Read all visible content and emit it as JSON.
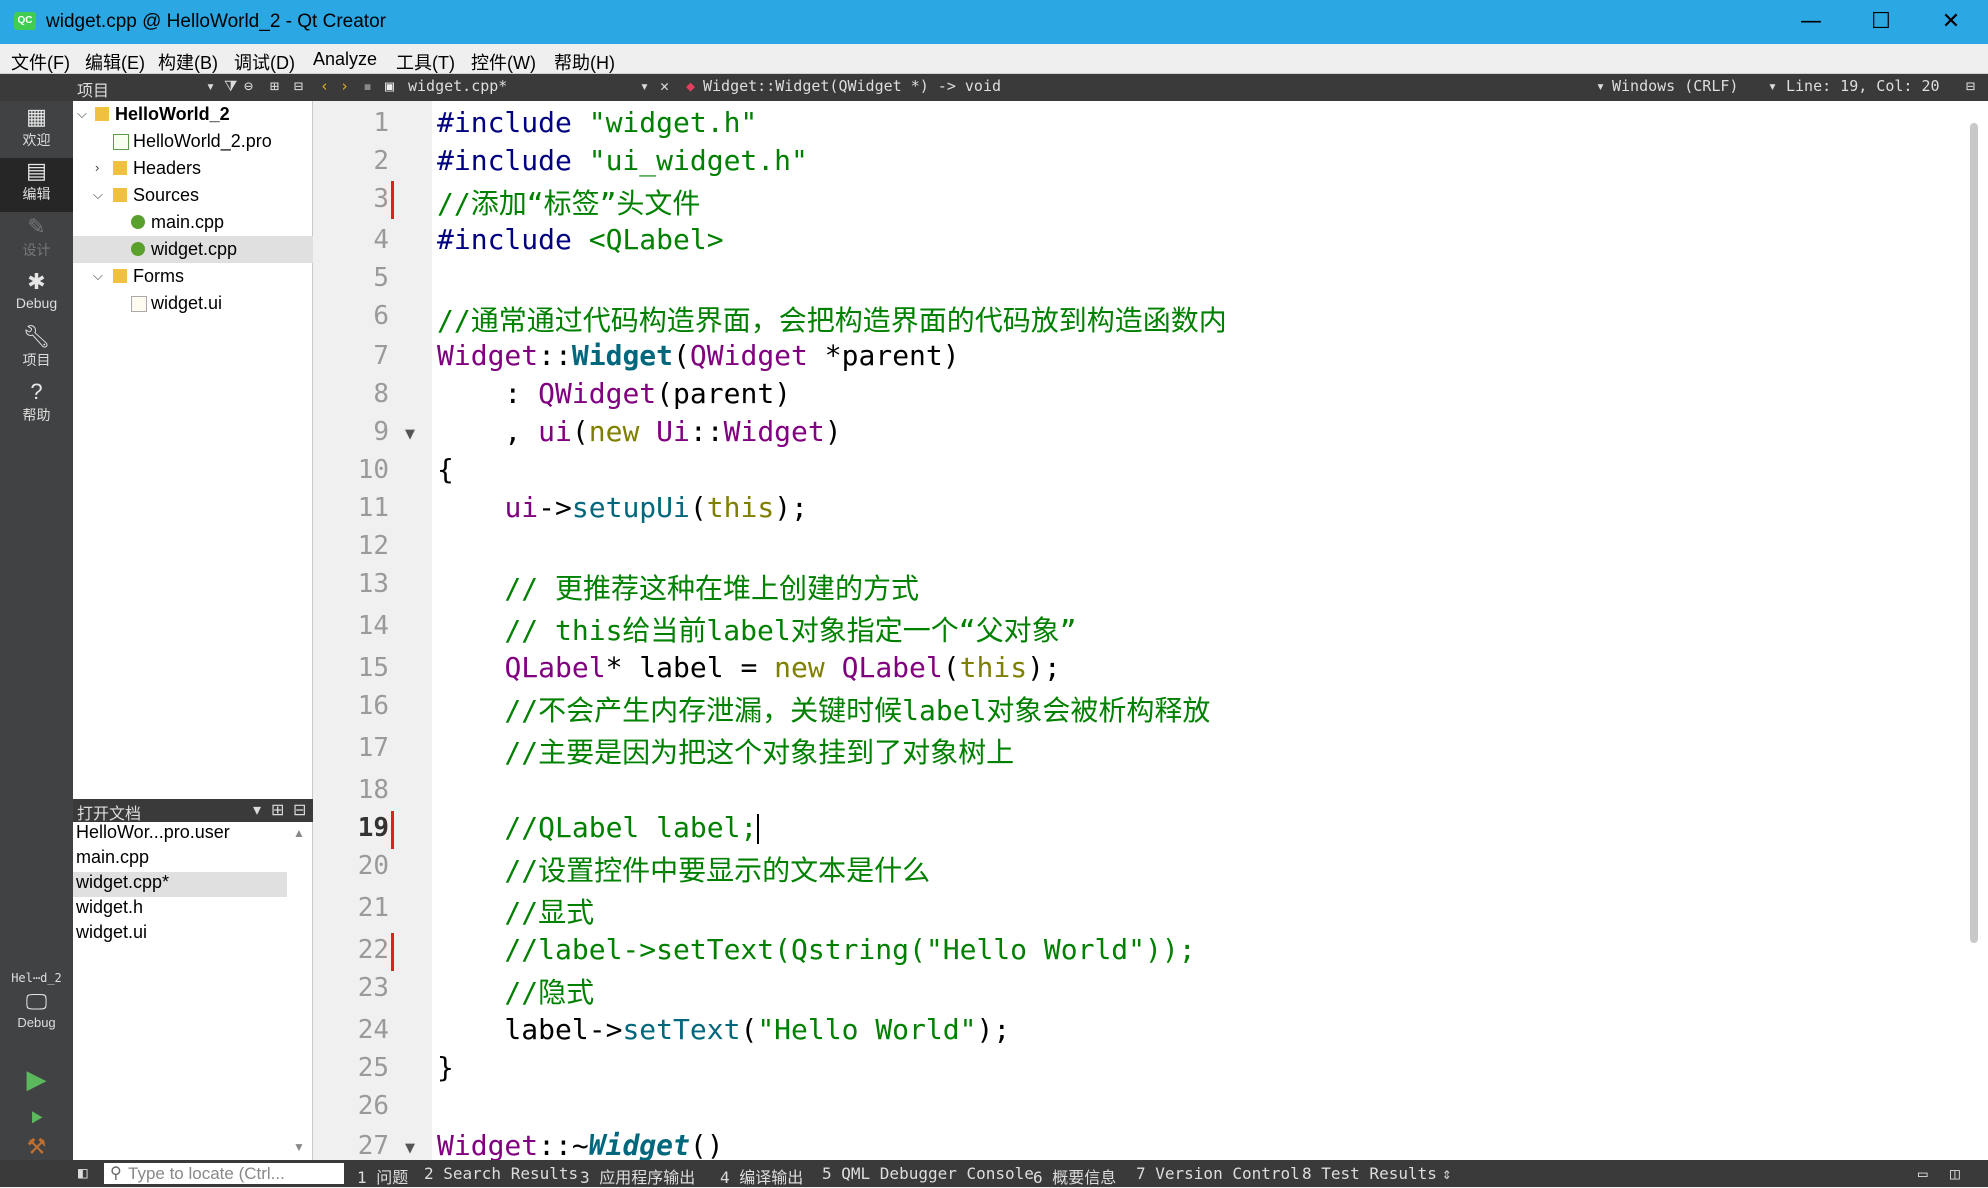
{
  "window": {
    "title": "widget.cpp @ HelloWorld_2 - Qt Creator",
    "app_badge": "QC",
    "minimize": "—",
    "maximize": "☐",
    "close": "✕"
  },
  "menu": [
    "文件(F)",
    "编辑(E)",
    "构建(B)",
    "调试(D)",
    "Analyze",
    "工具(T)",
    "控件(W)",
    "帮助(H)"
  ],
  "toolbar": {
    "panel_title": "项目",
    "file_tab": "widget.cpp*",
    "function_selector": "Widget::Widget(QWidget *) -> void",
    "line_ending": "Windows (CRLF)",
    "cursor_pos": "Line: 19, Col: 20"
  },
  "modes": [
    {
      "label": "欢迎",
      "icon": "grid-icon"
    },
    {
      "label": "编辑",
      "icon": "edit-icon"
    },
    {
      "label": "设计",
      "icon": "pencil-icon"
    },
    {
      "label": "Debug",
      "icon": "bug-icon"
    },
    {
      "label": "项目",
      "icon": "wrench-icon"
    },
    {
      "label": "帮助",
      "icon": "help-icon"
    }
  ],
  "kit": {
    "project": "Hel⋯d_2",
    "config": "Debug"
  },
  "project_tree": [
    {
      "label": "HelloWorld_2",
      "indent": 0,
      "expanded": true,
      "bold": true
    },
    {
      "label": "HelloWorld_2.pro",
      "indent": 1
    },
    {
      "label": "Headers",
      "indent": 1,
      "expanded": false
    },
    {
      "label": "Sources",
      "indent": 1,
      "expanded": true
    },
    {
      "label": "main.cpp",
      "indent": 2
    },
    {
      "label": "widget.cpp",
      "indent": 2,
      "selected": true
    },
    {
      "label": "Forms",
      "indent": 1,
      "expanded": true
    },
    {
      "label": "widget.ui",
      "indent": 2
    }
  ],
  "open_docs": {
    "title": "打开文档",
    "items": [
      "HelloWor...pro.user",
      "main.cpp",
      "widget.cpp*",
      "widget.h",
      "widget.ui"
    ],
    "selected": 2
  },
  "editor": {
    "current_line": 19,
    "line_numbers": [
      "1",
      "2",
      "3",
      "4",
      "5",
      "6",
      "7",
      "8",
      "9",
      "10",
      "11",
      "12",
      "13",
      "14",
      "15",
      "16",
      "17",
      "18",
      "19",
      "20",
      "21",
      "22",
      "23",
      "24",
      "25",
      "26",
      "27"
    ],
    "lines": {
      "l1": [
        "#include ",
        "\"widget.h\""
      ],
      "l2": [
        "#include ",
        "\"ui_widget.h\""
      ],
      "l3": "//添加“标签”头文件",
      "l4": [
        "#include ",
        "<QLabel>"
      ],
      "l6": "//通常通过代码构造界面，会把构造界面的代码放到构造函数内",
      "l7": [
        "Widget",
        "::",
        "Widget",
        "(",
        "QWidget",
        " *parent)"
      ],
      "l8": [
        "    : ",
        "QWidget",
        "(parent)"
      ],
      "l9": [
        "    , ",
        "ui",
        "(",
        "new",
        " ",
        "Ui",
        "::",
        "Widget",
        ")"
      ],
      "l10": "{",
      "l11": [
        "    ",
        "ui",
        "->",
        "setupUi",
        "(",
        "this",
        ");"
      ],
      "l13": "    // 更推荐这种在堆上创建的方式",
      "l14": "    // this给当前label对象指定一个“父对象”",
      "l15": [
        "    ",
        "QLabel",
        "* label = ",
        "new",
        " ",
        "QLabel",
        "(",
        "this",
        ");"
      ],
      "l16": "    //不会产生内存泄漏，关键时候label对象会被析构释放",
      "l17": "    //主要是因为把这个对象挂到了对象树上",
      "l19": "    //QLabel label;",
      "l20": "    //设置控件中要显示的文本是什么",
      "l21": "    //显式",
      "l22": "    //label->setText(Qstring(\"Hello World\"));",
      "l23": "    //隐式",
      "l24": [
        "    label->",
        "setText",
        "(",
        "\"Hello World\"",
        ");"
      ],
      "l25": "}",
      "l27": [
        "Widget",
        "::~",
        "Widget",
        "()"
      ]
    }
  },
  "bottom": {
    "locate_placeholder": "Type to locate (Ctrl...",
    "tabs": [
      "1 问题",
      "2 Search Results",
      "3 应用程序输出",
      "4 编译输出",
      "5 QML Debugger Console",
      "6 概要信息",
      "7 Version Control",
      "8 Test Results"
    ]
  }
}
